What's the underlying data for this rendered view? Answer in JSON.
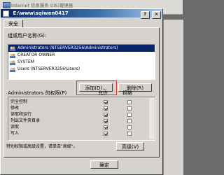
{
  "background": {
    "title": "Internet 信息服务 (IIS)管理器"
  },
  "dialog": {
    "title": "E:\\www\\sqiwen0417",
    "tab_security": "安全",
    "group_label": "组或用户名称(G):",
    "users": [
      {
        "name": "Administrators (NTSERVER3256\\Administrators)",
        "selected": true
      },
      {
        "name": "CREATOR OWNER",
        "selected": false
      },
      {
        "name": "SYSTEM",
        "selected": false
      },
      {
        "name": "Users (NTSERVER3256\\Users)",
        "selected": false
      }
    ],
    "add_button": "添加(D)...",
    "remove_button": "删除(R)",
    "perm_label": "Administrators 的权限(P)",
    "allow_header": "允许",
    "deny_header": "拒绝",
    "permissions": [
      {
        "name": "完全控制",
        "allow": true,
        "deny": false
      },
      {
        "name": "修改",
        "allow": true,
        "deny": false
      },
      {
        "name": "读取和运行",
        "allow": true,
        "deny": false
      },
      {
        "name": "列出文件夹目录",
        "allow": true,
        "deny": false
      },
      {
        "name": "读取",
        "allow": true,
        "deny": false
      },
      {
        "name": "写入",
        "allow": true,
        "deny": false
      }
    ],
    "special_note": "特别权限或高级设置，请单击\"高级\"。",
    "advanced_button": "高级(V)",
    "ok_button": "确定"
  }
}
